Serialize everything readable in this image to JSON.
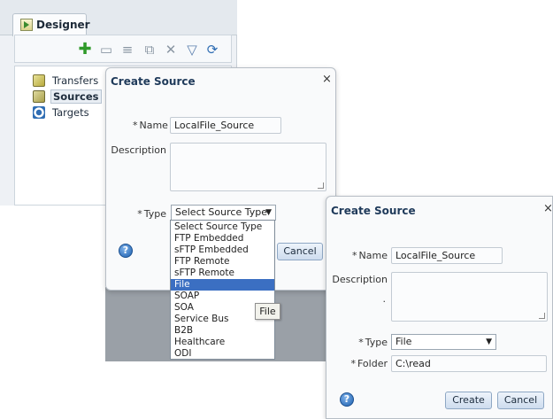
{
  "designer": {
    "tab_label": "Designer",
    "toolbar": [
      "add-icon",
      "folder-icon",
      "edit-icon",
      "copy-icon",
      "delete-icon",
      "filter-icon",
      "refresh-icon"
    ],
    "tree": [
      {
        "label": "Transfers",
        "icon": "transfers-icon"
      },
      {
        "label": "Sources",
        "icon": "sources-icon",
        "selected": true
      },
      {
        "label": "Targets",
        "icon": "targets-icon"
      }
    ]
  },
  "dialog1": {
    "title": "Create Source",
    "close": "×",
    "name_label": "Name",
    "name_value": "LocalFile_Source",
    "description_label": "Description",
    "type_label": "Type",
    "type_value": "Select Source Type",
    "required_mark": "*",
    "cancel_label": "Cancel",
    "help": "?",
    "type_options": [
      "Select Source Type",
      "FTP Embedded",
      "sFTP Embedded",
      "FTP Remote",
      "sFTP Remote",
      "File",
      "SOAP",
      "SOA",
      "Service Bus",
      "B2B",
      "Healthcare",
      "ODI"
    ],
    "highlighted_option": "File",
    "tooltip": "File"
  },
  "dialog2": {
    "title": "Create Source",
    "close": "×",
    "name_label": "Name",
    "name_value": "LocalFile_Source",
    "description_label": "Description",
    "description_extra": ".",
    "type_label": "Type",
    "type_value": "File",
    "folder_label": "Folder",
    "folder_value": "C:\\read",
    "required_mark": "*",
    "create_label": "Create",
    "cancel_label": "Cancel",
    "help": "?"
  },
  "colors": {
    "accent": "#3b6fc2",
    "title": "#1f3a5a",
    "button_border": "#8ea7c4"
  }
}
